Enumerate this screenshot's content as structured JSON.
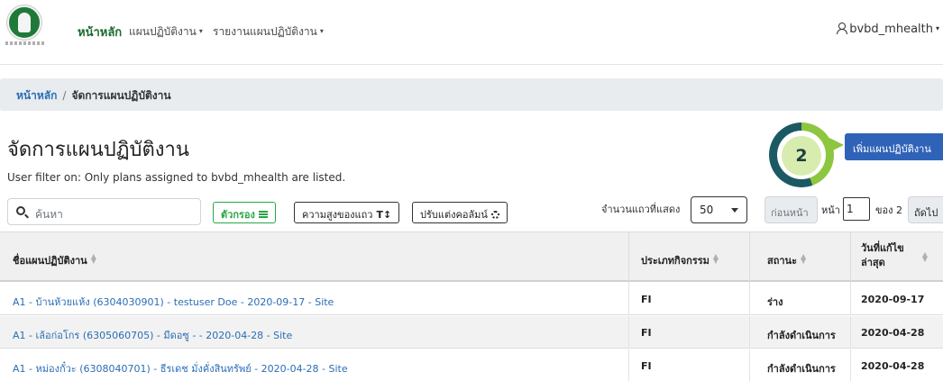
{
  "navbar": {
    "home": "หน้าหลัก",
    "plans": "แผนปฏิบัติงาน",
    "reports": "รายงานแผนปฏิบัติงาน",
    "user": "bvbd_mhealth"
  },
  "breadcrumb": {
    "home": "หน้าหลัก",
    "current": "จัดการแผนปฏิบัติงาน"
  },
  "page": {
    "title": "จัดการแผนปฏิบัติงาน",
    "filter_note": "User filter on: Only plans assigned to bvbd_mhealth are listed.",
    "add_button": "เพิ่มแผนปฏิบัติงาน"
  },
  "callout": {
    "number": "2"
  },
  "toolbar": {
    "search_placeholder": "ค้นหา",
    "filter_button": "ตัวกรอง",
    "row_height_button": "ความสูงของแถว",
    "row_height_icon_text": "T↕",
    "columns_button": "ปรับแต่งคอลัมน์",
    "rows_label": "จำนวนแถวที่แสดง",
    "rows_value": "50",
    "prev_button": "ก่อนหน้า",
    "page_label": "หน้า",
    "page_value": "1",
    "of_label": "ของ 2",
    "next_button": "ถัดไป"
  },
  "table": {
    "headers": [
      "ชื่อแผนปฏิบัติงาน",
      "ประเภทกิจกรรม",
      "สถานะ",
      "วันที่แก้ไขล่าสุด"
    ],
    "rows": [
      {
        "name": "A1 - บ้านห้วยแห้ง (6304030901) - testuser Doe - 2020-09-17 - Site",
        "type": "FI",
        "status": "ร่าง",
        "date": "2020-09-17"
      },
      {
        "name": "A1 - เล้อก่อโกร (6305060705) - มีดอซู - - 2020-04-28 - Site",
        "type": "FI",
        "status": "กำลังดำเนินการ",
        "date": "2020-04-28"
      },
      {
        "name": "A1 - หม่องกั๋วะ (6308040701) - ธีรเดช มั่งคั่งสินทรัพย์ - 2020-04-28 - Site",
        "type": "FI",
        "status": "กำลังดำเนินการ",
        "date": "2020-04-28"
      }
    ]
  },
  "icons": [
    "logo-emblem",
    "user-icon",
    "search-icon",
    "filter-icon",
    "gear-icon",
    "sort-icon",
    "caret-down-icon"
  ],
  "colors": {
    "brand_green": "#1a6b2c",
    "primary_blue": "#2f63b8",
    "link_blue": "#2a6db5",
    "callout_green": "#8dc63f",
    "callout_teal": "#1c5a63"
  }
}
